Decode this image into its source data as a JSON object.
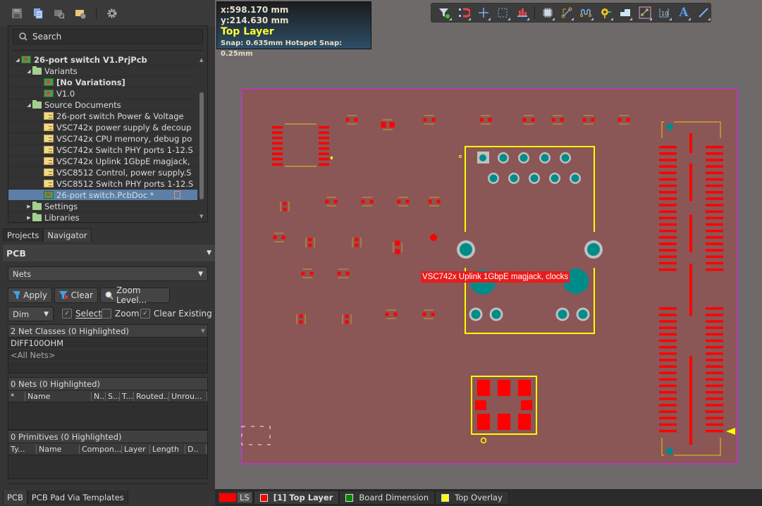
{
  "toolbar": {
    "icons": [
      "save-icon",
      "copy-documents-icon",
      "browse-folder-icon",
      "folder-settings-icon",
      "gear-icon"
    ]
  },
  "projects": {
    "search_placeholder": "Search",
    "tree": [
      {
        "label": "26-port switch V1.PrjPcb",
        "level": 0,
        "type": "project",
        "expanded": true,
        "bold": true
      },
      {
        "label": "Variants",
        "level": 1,
        "type": "folder",
        "expanded": true
      },
      {
        "label": "[No Variations]",
        "level": 2,
        "type": "variant",
        "bold": true
      },
      {
        "label": "V1.0",
        "level": 2,
        "type": "variant"
      },
      {
        "label": "Source Documents",
        "level": 1,
        "type": "folder",
        "expanded": true
      },
      {
        "label": "26-port switch Power & Voltage",
        "level": 2,
        "type": "schdoc"
      },
      {
        "label": "VSC742x power supply & decoup",
        "level": 2,
        "type": "schdoc"
      },
      {
        "label": "VSC742x CPU memory, debug po",
        "level": 2,
        "type": "schdoc"
      },
      {
        "label": "VSC742x Switch PHY ports 1-12.S",
        "level": 2,
        "type": "schdoc"
      },
      {
        "label": "VSC742x Uplink 1GbpE magjack,",
        "level": 2,
        "type": "schdoc"
      },
      {
        "label": "VSC8512 Control, power supply.S",
        "level": 2,
        "type": "schdoc"
      },
      {
        "label": "VSC8512 Switch PHY ports 1-12.S",
        "level": 2,
        "type": "schdoc"
      },
      {
        "label": "26-port switch.PcbDoc *",
        "level": 2,
        "type": "pcbdoc",
        "selected": true
      },
      {
        "label": "Settings",
        "level": 1,
        "type": "folder",
        "expanded": false
      },
      {
        "label": "Libraries",
        "level": 1,
        "type": "folder",
        "expanded": false
      }
    ]
  },
  "panel_tabs": [
    "Projects",
    "Navigator"
  ],
  "pcb_panel": {
    "title": "PCB",
    "mode": "Nets",
    "buttons": {
      "apply": "Apply",
      "clear": "Clear",
      "zoom_level": "Zoom Level..."
    },
    "dim": "Dim",
    "checks": [
      {
        "label": "Select",
        "checked": true
      },
      {
        "label": "Zoom",
        "checked": false
      },
      {
        "label": "Clear Existing",
        "checked": true
      }
    ],
    "net_classes": {
      "header": "2 Net Classes (0 Highlighted)",
      "items": [
        "DIFF100OHM",
        "<All Nets>"
      ]
    },
    "nets": {
      "header": "0 Nets (0 Highlighted)",
      "columns": [
        "*",
        "Name",
        "N..",
        "S...",
        "T...",
        "Routed...",
        "Unrou..."
      ]
    },
    "primitives": {
      "header": "0 Primitives (0 Highlighted)",
      "columns": [
        "Ty...",
        "Name",
        "Compon...",
        "Layer",
        "Length",
        "D.."
      ]
    }
  },
  "bottom_tabs": [
    "PCB",
    "PCB Pad Via Templates"
  ],
  "hud": {
    "x": "x:598.170  mm",
    "y": "y:214.630  mm",
    "layer": "Top Layer",
    "snap": "Snap: 0.635mm Hotspot Snap: 0.25mm"
  },
  "canvas_toolbar": [
    "filter-icon",
    "interactive-routing-icon",
    "place-crosshair-icon",
    "select-rectangle-icon",
    "align-icon",
    "component-icon",
    "route-icon",
    "differential-pair-icon",
    "via-icon",
    "polygon-icon",
    "track-icon",
    "dimension-icon",
    "text-icon",
    "line-icon"
  ],
  "board": {
    "tooltip": "VSC742x Uplink 1GbpE magjack, clocks",
    "colors": {
      "board": "#8b5656",
      "outline": "#b040b0",
      "pad": "#ff0000",
      "overlay": "#ffff00",
      "overlay_dim": "#c8a030",
      "hole": "#008b8b",
      "hole_ring": "#c0c0c0",
      "background": "#6e6a6a"
    }
  },
  "layer_tabs": [
    {
      "label": "LS",
      "color": "#ff0000"
    },
    {
      "label": "[1] Top Layer",
      "color": "#ff0000",
      "active": true
    },
    {
      "label": "Board Dimension",
      "color": "#008000"
    },
    {
      "label": "Top Overlay",
      "color": "#ffff00"
    }
  ]
}
